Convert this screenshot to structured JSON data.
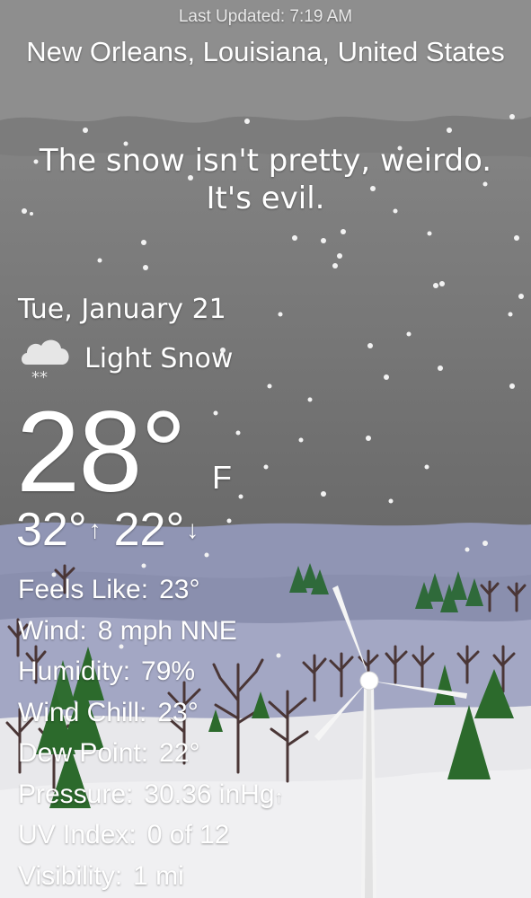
{
  "header": {
    "last_updated": "Last Updated: 7:19 AM",
    "location": "New Orleans, Louisiana, United States"
  },
  "quote": {
    "line1": "The snow isn't pretty, weirdo.",
    "line2": "It's evil."
  },
  "current": {
    "date": "Tue, January 21",
    "condition_icon": "cloud-snow-icon",
    "condition": "Light Snow",
    "temperature": "28°",
    "unit": "F",
    "high": "32°",
    "high_arrow": "↑",
    "low": "22°",
    "low_arrow": "↓"
  },
  "details": [
    {
      "label": "Feels Like:",
      "value": "23°"
    },
    {
      "label": "Wind:",
      "value": "8 mph NNE"
    },
    {
      "label": "Humidity:",
      "value": "79%"
    },
    {
      "label": "Wind Chill:",
      "value": "23°"
    },
    {
      "label": "Dew Point:",
      "value": "22°"
    },
    {
      "label": "Pressure:",
      "value": "30.36 inHg",
      "trend": "↑"
    },
    {
      "label": "UV Index:",
      "value": "0 of 12"
    },
    {
      "label": "Visibility:",
      "value": "1 mi"
    }
  ],
  "colors": {
    "sky_top": "#8a8a8a",
    "sky_bottom": "#666666",
    "hills": "#8f93b0",
    "snow": "#e9e9ec",
    "pine": "#2e6b2f",
    "trunk": "#4a3636",
    "turbine": "#f2f2f2"
  }
}
